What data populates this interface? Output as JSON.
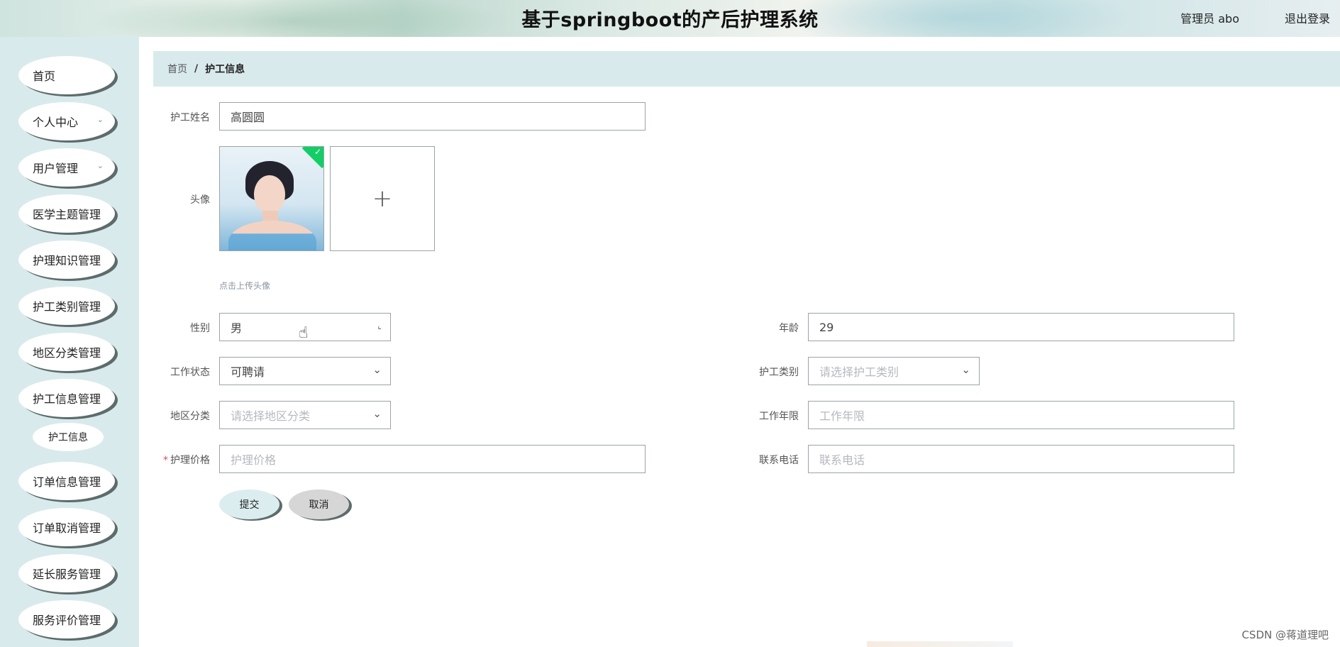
{
  "header": {
    "title": "基于springboot的产后护理系统",
    "admin_label": "管理员 abo",
    "logout_label": "退出登录"
  },
  "sidebar": {
    "items": [
      {
        "label": "首页",
        "has_submenu": false
      },
      {
        "label": "个人中心",
        "has_submenu": true
      },
      {
        "label": "用户管理",
        "has_submenu": true
      },
      {
        "label": "医学主题管理",
        "has_submenu": false
      },
      {
        "label": "护理知识管理",
        "has_submenu": false
      },
      {
        "label": "护工类别管理",
        "has_submenu": false
      },
      {
        "label": "地区分类管理",
        "has_submenu": false
      },
      {
        "label": "护工信息管理",
        "has_submenu": false
      },
      {
        "label": "订单信息管理",
        "has_submenu": false
      },
      {
        "label": "订单取消管理",
        "has_submenu": false
      },
      {
        "label": "延长服务管理",
        "has_submenu": false
      },
      {
        "label": "服务评价管理",
        "has_submenu": false
      }
    ],
    "sub_item": {
      "label": "护工信息"
    }
  },
  "breadcrumb": {
    "home": "首页",
    "separator": "/",
    "current": "护工信息"
  },
  "form": {
    "name": {
      "label": "护工姓名",
      "value": "高圆圆"
    },
    "avatar": {
      "label": "头像",
      "hint": "点击上传头像",
      "uploaded": true
    },
    "gender": {
      "label": "性别",
      "value": "男"
    },
    "age": {
      "label": "年龄",
      "value": "29"
    },
    "work_status": {
      "label": "工作状态",
      "value": "可聘请"
    },
    "nurse_category": {
      "label": "护工类别",
      "placeholder": "请选择护工类别"
    },
    "region": {
      "label": "地区分类",
      "placeholder": "请选择地区分类"
    },
    "work_years": {
      "label": "工作年限",
      "placeholder": "工作年限"
    },
    "price": {
      "label": "护理价格",
      "placeholder": "护理价格",
      "required": true
    },
    "phone": {
      "label": "联系电话",
      "placeholder": "联系电话"
    },
    "submit_label": "提交",
    "cancel_label": "取消"
  },
  "watermark": "CSDN @蒋道理吧",
  "colors": {
    "sidebar_bg": "#d9eaed",
    "breadcrumb_bg": "#d9eaed",
    "success_badge": "#13ce66",
    "required_mark": "#e04c4c"
  }
}
